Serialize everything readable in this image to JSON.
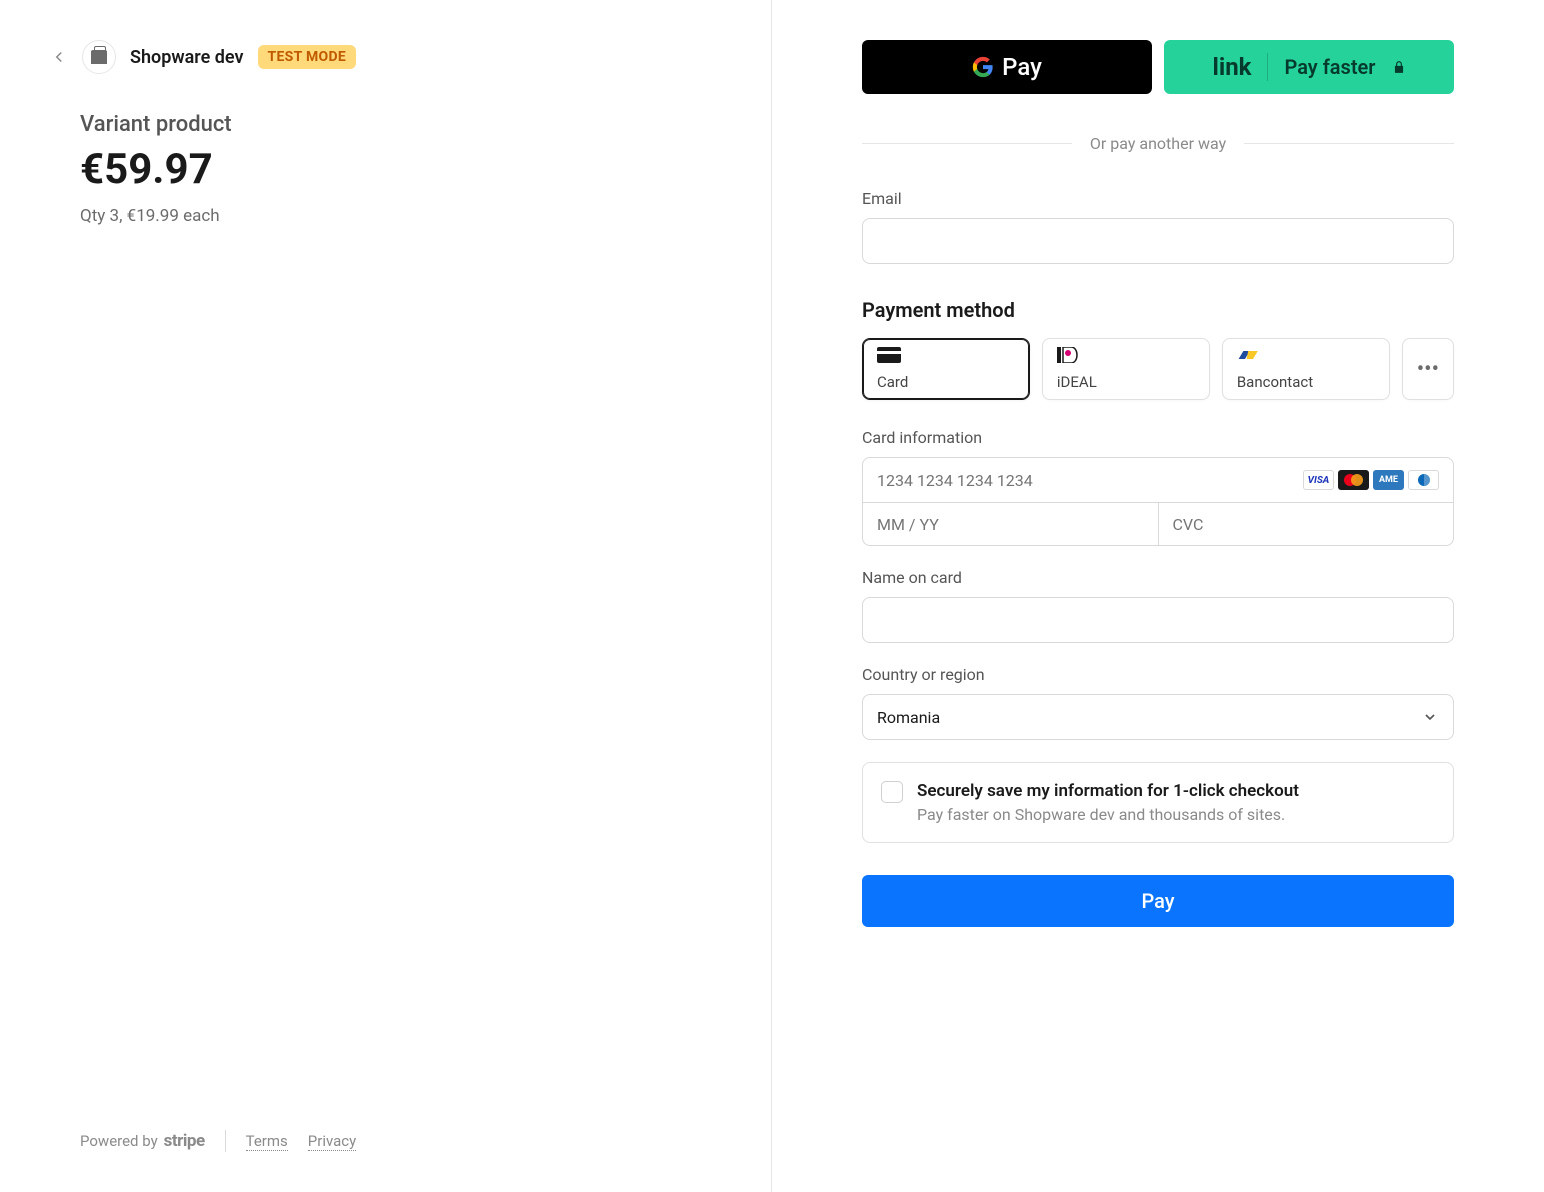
{
  "merchant": {
    "name": "Shopware dev",
    "badge": "TEST MODE"
  },
  "order": {
    "product_name": "Variant product",
    "total": "€59.97",
    "qty_line": "Qty 3, €19.99 each"
  },
  "footer": {
    "powered_by_prefix": "Powered by",
    "brand": "stripe",
    "terms": "Terms",
    "privacy": "Privacy"
  },
  "wallets": {
    "gpay_label": "Pay",
    "link_brand": "link",
    "link_label": "Pay faster"
  },
  "divider_text": "Or pay another way",
  "email": {
    "label": "Email"
  },
  "payment_method": {
    "title": "Payment method",
    "options": {
      "card": "Card",
      "ideal": "iDEAL",
      "bancontact": "Bancontact"
    }
  },
  "card_info": {
    "label": "Card information",
    "number_placeholder": "1234 1234 1234 1234",
    "expiry_placeholder": "MM / YY",
    "cvc_placeholder": "CVC"
  },
  "name_on_card": {
    "label": "Name on card"
  },
  "country": {
    "label": "Country or region",
    "selected": "Romania"
  },
  "save_info": {
    "title": "Securely save my information for 1-click checkout",
    "subtitle": "Pay faster on Shopware dev and thousands of sites."
  },
  "pay_button": "Pay"
}
